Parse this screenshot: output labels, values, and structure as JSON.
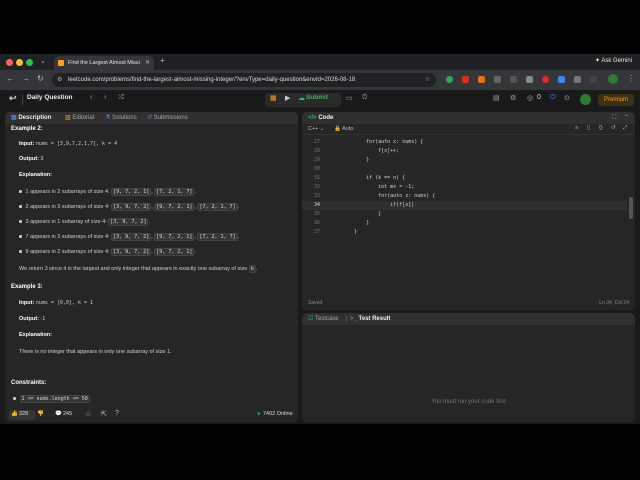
{
  "browser": {
    "tab_title": "Find the Largest Almost Missi",
    "url": "leetcode.com/problems/find-the-largest-almost-missing-integer/?envType=daily-question&envId=2026-08-18",
    "gemini": "Ask Gemini"
  },
  "toolbar": {
    "daily_question": "Daily Question",
    "submit": "Submit",
    "premium": "Premium",
    "coins": "0"
  },
  "left_tabs": [
    "Description",
    "Editorial",
    "Solutions",
    "Submissions"
  ],
  "description": {
    "example2_title": "Example 2:",
    "ex2_input_label": "Input:",
    "ex2_input_value": "nums = [3,9,7,2,1,7], k = 4",
    "ex2_output_label": "Output:",
    "ex2_output_value": "3",
    "explanation_label": "Explanation:",
    "ex2_bullets": [
      {
        "text": "1 appears in 2 subarrays of size 4:",
        "codes": [
          "[9, 7, 2, 1]",
          "[7, 2, 1, 7]"
        ],
        "end": "."
      },
      {
        "text": "2 appears in 3 subarrays of size 4:",
        "codes": [
          "[3, 9, 7, 2]",
          "[9, 7, 2, 1]",
          "[7, 2, 1, 7]"
        ],
        "end": "."
      },
      {
        "text": "3 appears in 1 subarray of size 4:",
        "codes": [
          "[3, 9, 7, 2]"
        ],
        "end": "."
      },
      {
        "text": "7 appears in 3 subarrays of size 4:",
        "codes": [
          "[3, 9, 7, 2]",
          "[9, 7, 2, 1]",
          "[7, 2, 1, 7]"
        ],
        "end": "."
      },
      {
        "text": "9 appears in 2 subarrays of size 4:",
        "codes": [
          "[3, 9, 7, 2]",
          "[9, 7, 2, 1]"
        ],
        "end": "."
      }
    ],
    "ex2_conclusion": "We return 3 since it is the largest and only integer that appears in exactly one subarray of size",
    "ex2_conclusion_code": "k",
    "example3_title": "Example 3:",
    "ex3_input_label": "Input:",
    "ex3_input_value": "nums = [0,0], k = 1",
    "ex3_output_label": "Output:",
    "ex3_output_value": "-1",
    "ex3_explanation_text": "There is no integer that appears in only one subarray of size 1.",
    "constraints_title": "Constraints:",
    "constraint1": "1 <= nums.length <= 50"
  },
  "footer": {
    "likes": "328",
    "comments": "245",
    "online": "7402 Online"
  },
  "editor": {
    "title": "Code",
    "language": "C++",
    "auto": "Auto",
    "saved": "Saved",
    "cursor": "Ln 34, Col 24",
    "lines": [
      {
        "n": "27",
        "t": "        for(auto x: nums) {"
      },
      {
        "n": "28",
        "t": "            f[x]++;"
      },
      {
        "n": "29",
        "t": "        }"
      },
      {
        "n": "30",
        "t": ""
      },
      {
        "n": "31",
        "t": "        if (k == n) {"
      },
      {
        "n": "32",
        "t": "            int mx = -1;"
      },
      {
        "n": "33",
        "t": "            for(auto x: nums) {"
      },
      {
        "n": "34",
        "t": "                if(f[x]|"
      },
      {
        "n": "35",
        "t": "            }"
      },
      {
        "n": "36",
        "t": "        }"
      },
      {
        "n": "37",
        "t": "    }"
      }
    ]
  },
  "bottom_panel": {
    "tab_testcase": "Testcase",
    "tab_result": "Test Result",
    "message": "You must run your code first"
  }
}
